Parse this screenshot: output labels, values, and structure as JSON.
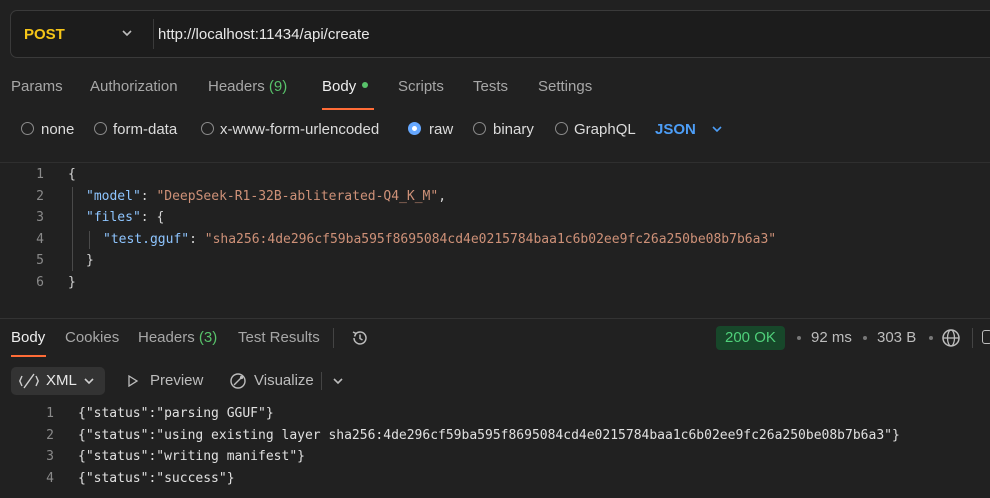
{
  "request": {
    "method": "POST",
    "url": "http://localhost:11434/api/create"
  },
  "tabs": {
    "params": "Params",
    "authorization": "Authorization",
    "headers": "Headers",
    "headers_count": "(9)",
    "body": "Body",
    "scripts": "Scripts",
    "tests": "Tests",
    "settings": "Settings"
  },
  "body_types": {
    "none": "none",
    "form_data": "form-data",
    "urlencoded": "x-www-form-urlencoded",
    "raw": "raw",
    "binary": "binary",
    "graphql": "GraphQL",
    "selected": "raw",
    "language": "JSON"
  },
  "editor": {
    "line_numbers": [
      "1",
      "2",
      "3",
      "4",
      "5",
      "6"
    ],
    "model_key": "\"model\"",
    "model_value": "\"DeepSeek-R1-32B-abliterated-Q4_K_M\"",
    "files_key": "\"files\"",
    "file_key": "\"test.gguf\"",
    "file_value": "\"sha256:4de296cf59ba595f8695084cd4e0215784baa1c6b02ee9fc26a250be08b7b6a3\""
  },
  "response": {
    "tabs": {
      "body": "Body",
      "cookies": "Cookies",
      "headers": "Headers",
      "headers_count": "(3)",
      "test_results": "Test Results"
    },
    "status": "200 OK",
    "time": "92 ms",
    "size": "303 B",
    "format": "XML",
    "preview": "Preview",
    "visualize": "Visualize",
    "line_numbers": [
      "1",
      "2",
      "3",
      "4"
    ],
    "lines": [
      "{\"status\":\"parsing GGUF\"}",
      "{\"status\":\"using existing layer sha256:4de296cf59ba595f8695084cd4e0215784baa1c6b02ee9fc26a250be08b7b6a3\"}",
      "{\"status\":\"writing manifest\"}",
      "{\"status\":\"success\"}"
    ]
  },
  "colors": {
    "accent": "#ff6c37",
    "method": "#f5c518",
    "ok_badge_bg": "#17472a",
    "ok_text": "#4fd07a",
    "json_link": "#4d9ef7",
    "count_green": "#58c26a"
  },
  "icons": [
    "chevron-down-icon",
    "history-icon",
    "globe-icon",
    "beautify-icon",
    "play-icon",
    "visualize-icon"
  ]
}
